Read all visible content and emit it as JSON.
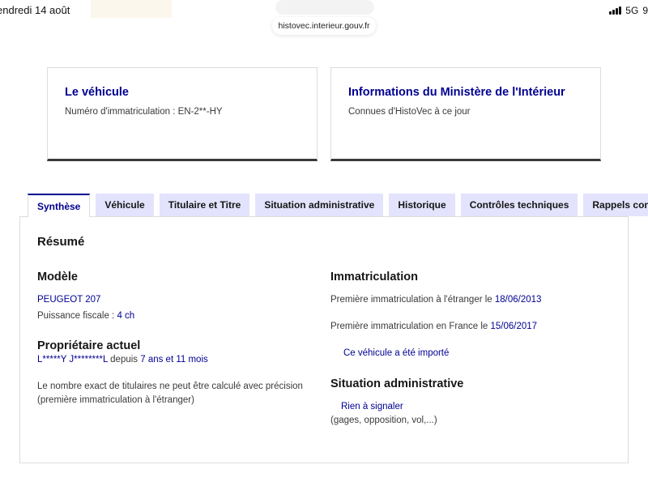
{
  "status_bar": {
    "date": "endredi 14 août",
    "network": "5G",
    "battery": "9"
  },
  "browser": {
    "url": "histovec.interieur.gouv.fr"
  },
  "cards": {
    "vehicle": {
      "title": "Le véhicule",
      "subtitle": "Numéro d'immatriculation : EN-2**-HY"
    },
    "ministry": {
      "title": "Informations du Ministère de l'Intérieur",
      "subtitle": "Connues d'HistoVec à ce jour"
    }
  },
  "tabs": [
    {
      "label": "Synthèse",
      "active": true
    },
    {
      "label": "Véhicule",
      "active": false
    },
    {
      "label": "Titulaire et Titre",
      "active": false
    },
    {
      "label": "Situation administrative",
      "active": false
    },
    {
      "label": "Historique",
      "active": false
    },
    {
      "label": "Contrôles techniques",
      "active": false
    },
    {
      "label": "Rappels constru",
      "active": false
    }
  ],
  "summary": {
    "title": "Résumé",
    "model": {
      "heading": "Modèle",
      "name": "PEUGEOT 207",
      "power_label": "Puissance fiscale : ",
      "power_value": "4 ch"
    },
    "owner": {
      "heading": "Propriétaire actuel",
      "name": "L*****Y J********L",
      "since_label": " depuis ",
      "since_value": "7 ans et 11 mois",
      "note_line1": "Le nombre exact de titulaires ne peut être calculé avec précision",
      "note_line2": "(première immatriculation à l'étranger)"
    },
    "registration": {
      "heading": "Immatriculation",
      "foreign_label": "Première immatriculation à l'étranger le ",
      "foreign_date": "18/06/2013",
      "france_label": "Première immatriculation en France le ",
      "france_date": "15/06/2017",
      "imported": "Ce véhicule a été importé"
    },
    "admin": {
      "heading": "Situation administrative",
      "status": "Rien à signaler",
      "detail": "(gages, opposition, vol,...)"
    }
  }
}
